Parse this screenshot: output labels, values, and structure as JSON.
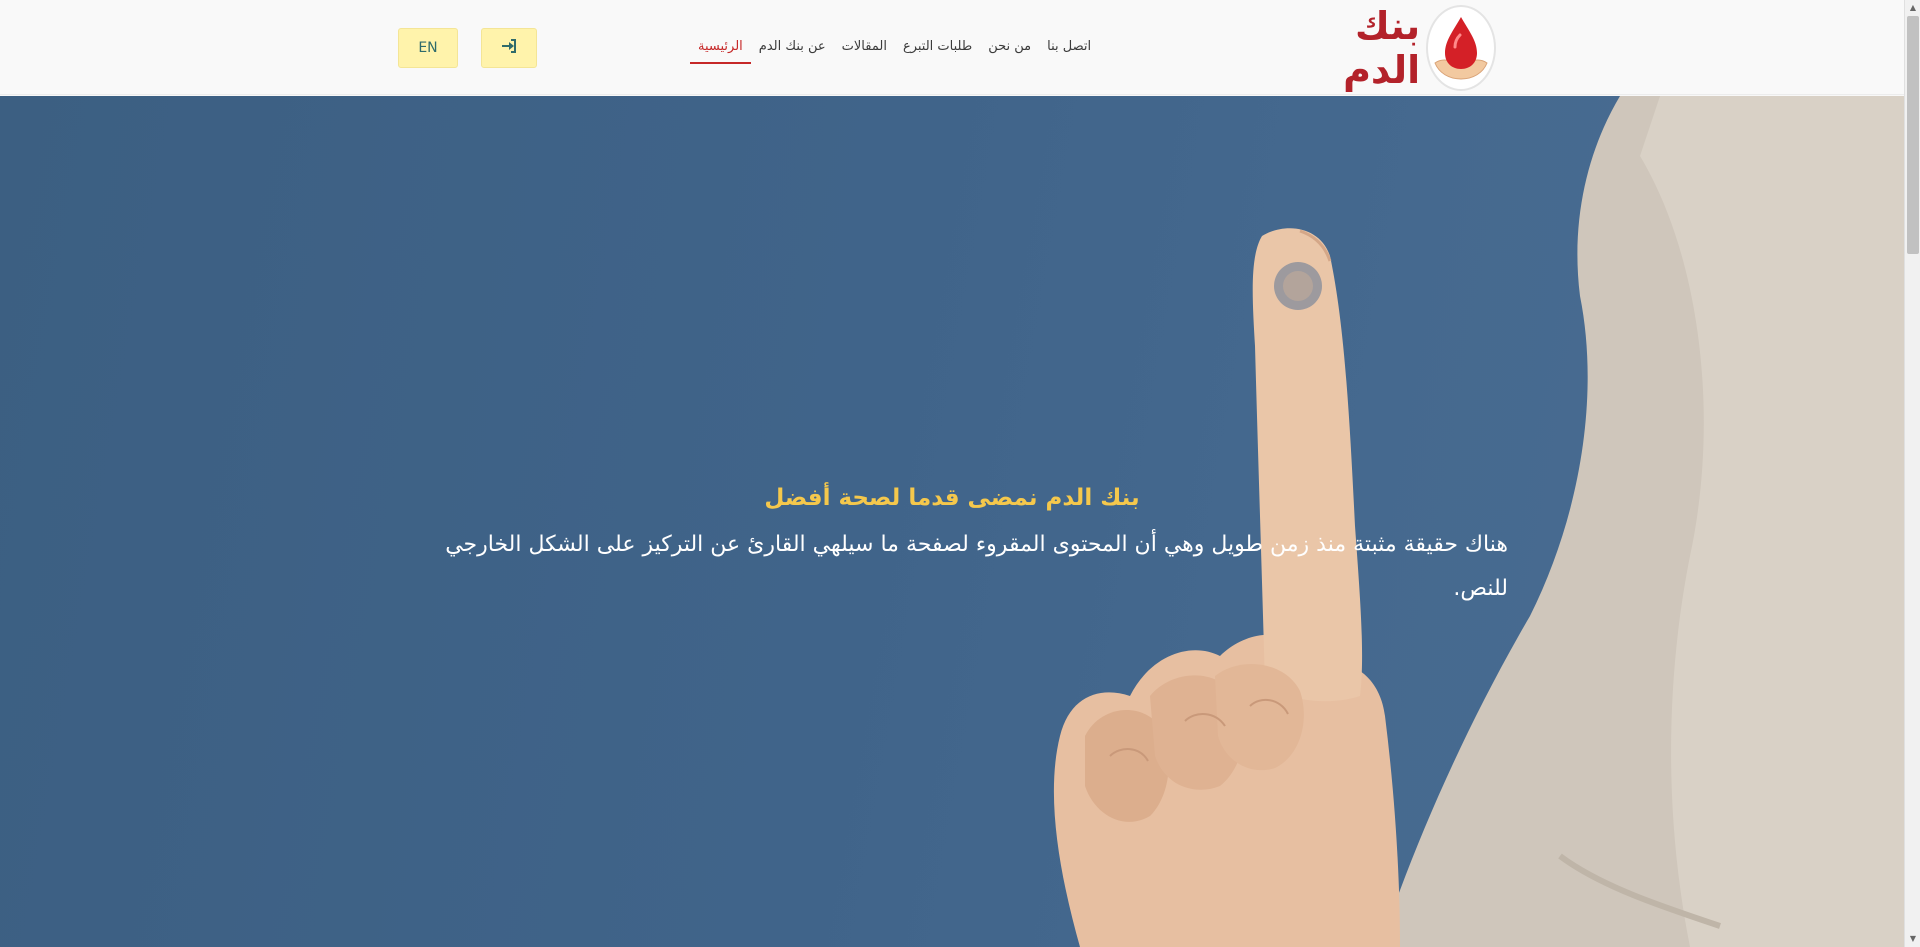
{
  "header": {
    "brand_name": "بنك الدم",
    "nav": [
      {
        "label": "الرئيسية",
        "active": true
      },
      {
        "label": "عن بنك الدم",
        "active": false
      },
      {
        "label": "المقالات",
        "active": false
      },
      {
        "label": "طلبات التبرع",
        "active": false
      },
      {
        "label": "من نحن",
        "active": false
      },
      {
        "label": "اتصل بنا",
        "active": false
      }
    ],
    "language_button": "EN",
    "login_icon": "sign-in-icon",
    "logo_icon": "blood-drop-hand-icon"
  },
  "hero": {
    "title": "بنك الدم نمضى قدما لصحة أفضل",
    "description": "هناك حقيقة مثبتة منذ زمن طويل وهي أن المحتوى المقروء لصفحة ما سيلهي القارئ عن التركيز على الشكل الخارجي للنص."
  },
  "colors": {
    "brand_red": "#b3222a",
    "active_nav": "#c62828",
    "hero_bg": "#40648a",
    "hero_title": "#f5c84c",
    "button_bg": "#fff3ab"
  }
}
